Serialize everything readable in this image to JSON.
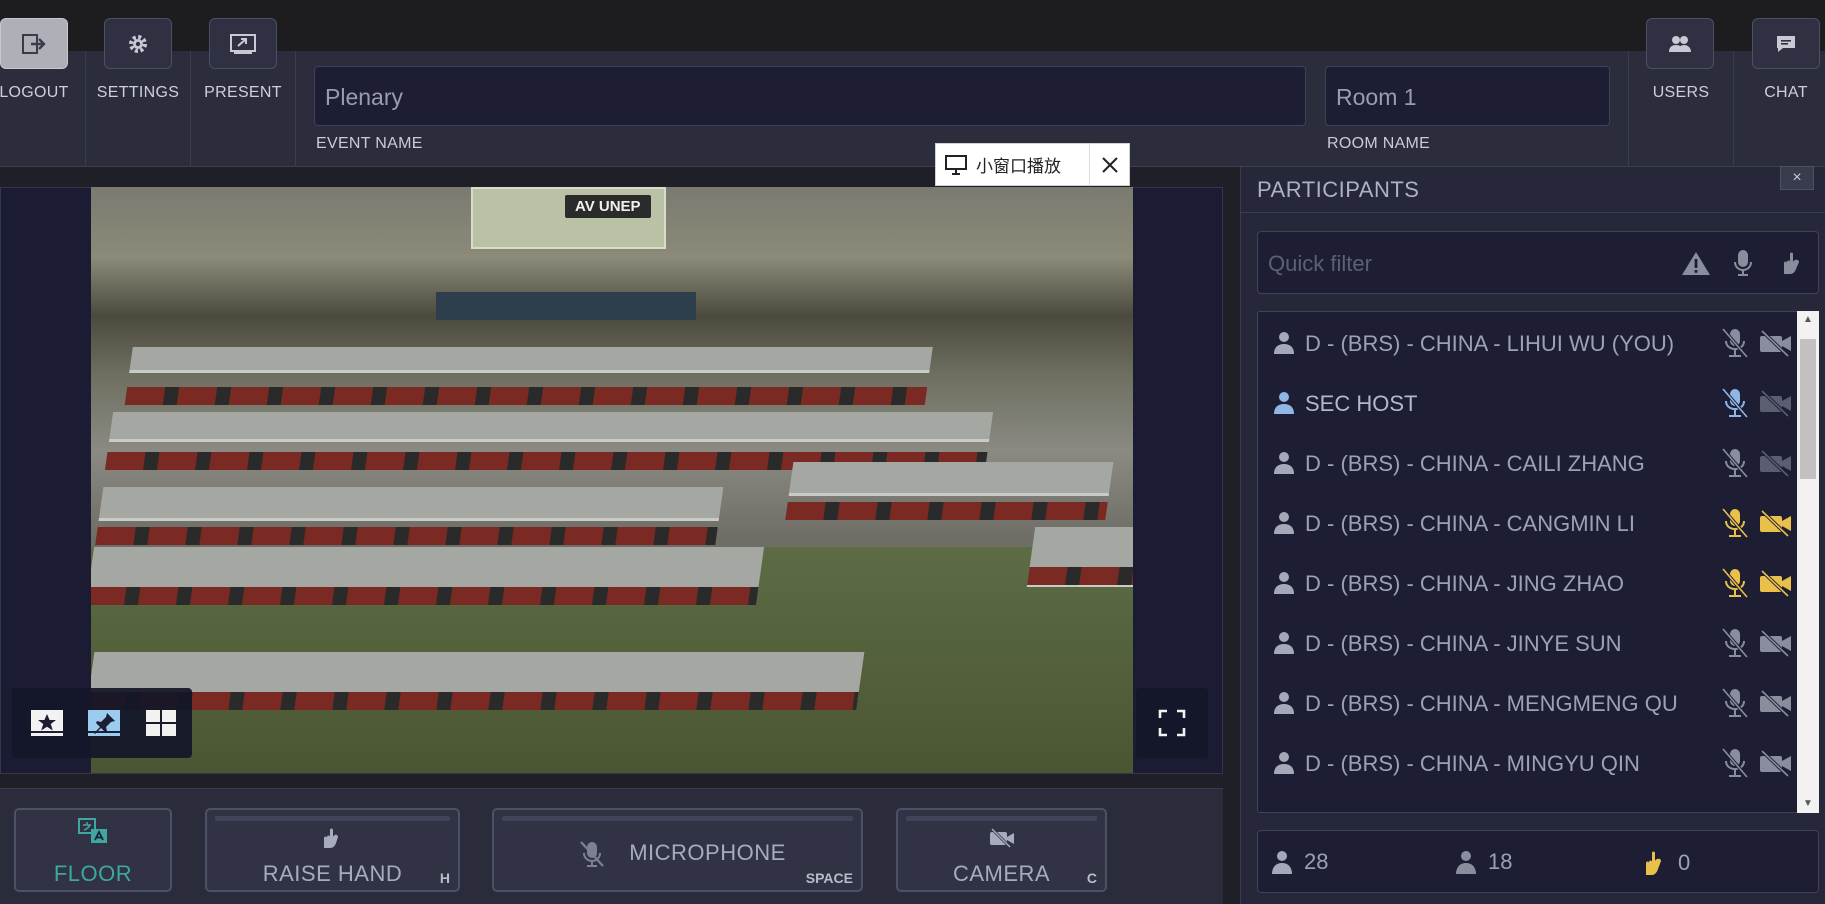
{
  "toolbar": {
    "logout_label": "LOGOUT",
    "settings_label": "SETTINGS",
    "present_label": "PRESENT",
    "event_name_value": "Plenary",
    "event_name_label": "EVENT NAME",
    "room_name_value": "Room 1",
    "room_name_label": "ROOM NAME",
    "users_label": "USERS",
    "chat_label": "CHAT"
  },
  "video": {
    "overlay_tag": "AV UNEP",
    "popup_label": "小窗口播放"
  },
  "bottom": {
    "floor_label": "FLOOR",
    "raise_hand_label": "RAISE HAND",
    "raise_hand_key": "H",
    "microphone_label": "MICROPHONE",
    "microphone_key": "SPACE",
    "camera_label": "CAMERA",
    "camera_key": "C"
  },
  "panel": {
    "title": "PARTICIPANTS",
    "close": "×",
    "filter_placeholder": "Quick filter",
    "participants": [
      {
        "name": "D - (BRS) - CHINA - LIHUI WU (YOU)",
        "mic_color": "#8a8d9e",
        "cam_color": "#8a8d9e",
        "icon_color": "#a5a8b8"
      },
      {
        "name": "SEC HOST",
        "mic_color": "#8fb6e6",
        "cam_color": "#5b5e70",
        "icon_color": "#8fb6e6"
      },
      {
        "name": "D - (BRS) - CHINA - CAILI ZHANG",
        "mic_color": "#8a8d9e",
        "cam_color": "#5b5e70",
        "icon_color": "#a5a8b8"
      },
      {
        "name": "D - (BRS) - CHINA - CANGMIN LI",
        "mic_color": "#e9c04a",
        "cam_color": "#e9c04a",
        "icon_color": "#a5a8b8"
      },
      {
        "name": "D - (BRS) - CHINA - JING ZHAO",
        "mic_color": "#e9c04a",
        "cam_color": "#e9c04a",
        "icon_color": "#a5a8b8"
      },
      {
        "name": "D - (BRS) - CHINA - JINYE SUN",
        "mic_color": "#8a8d9e",
        "cam_color": "#8a8d9e",
        "icon_color": "#a5a8b8"
      },
      {
        "name": "D - (BRS) - CHINA - MENGMENG QU",
        "mic_color": "#8a8d9e",
        "cam_color": "#8a8d9e",
        "icon_color": "#a5a8b8"
      },
      {
        "name": "D - (BRS) - CHINA - MINGYU QIN",
        "mic_color": "#8a8d9e",
        "cam_color": "#8a8d9e",
        "icon_color": "#a5a8b8"
      }
    ],
    "stats": {
      "total": "28",
      "present": "18",
      "raised_hands": "0"
    }
  }
}
